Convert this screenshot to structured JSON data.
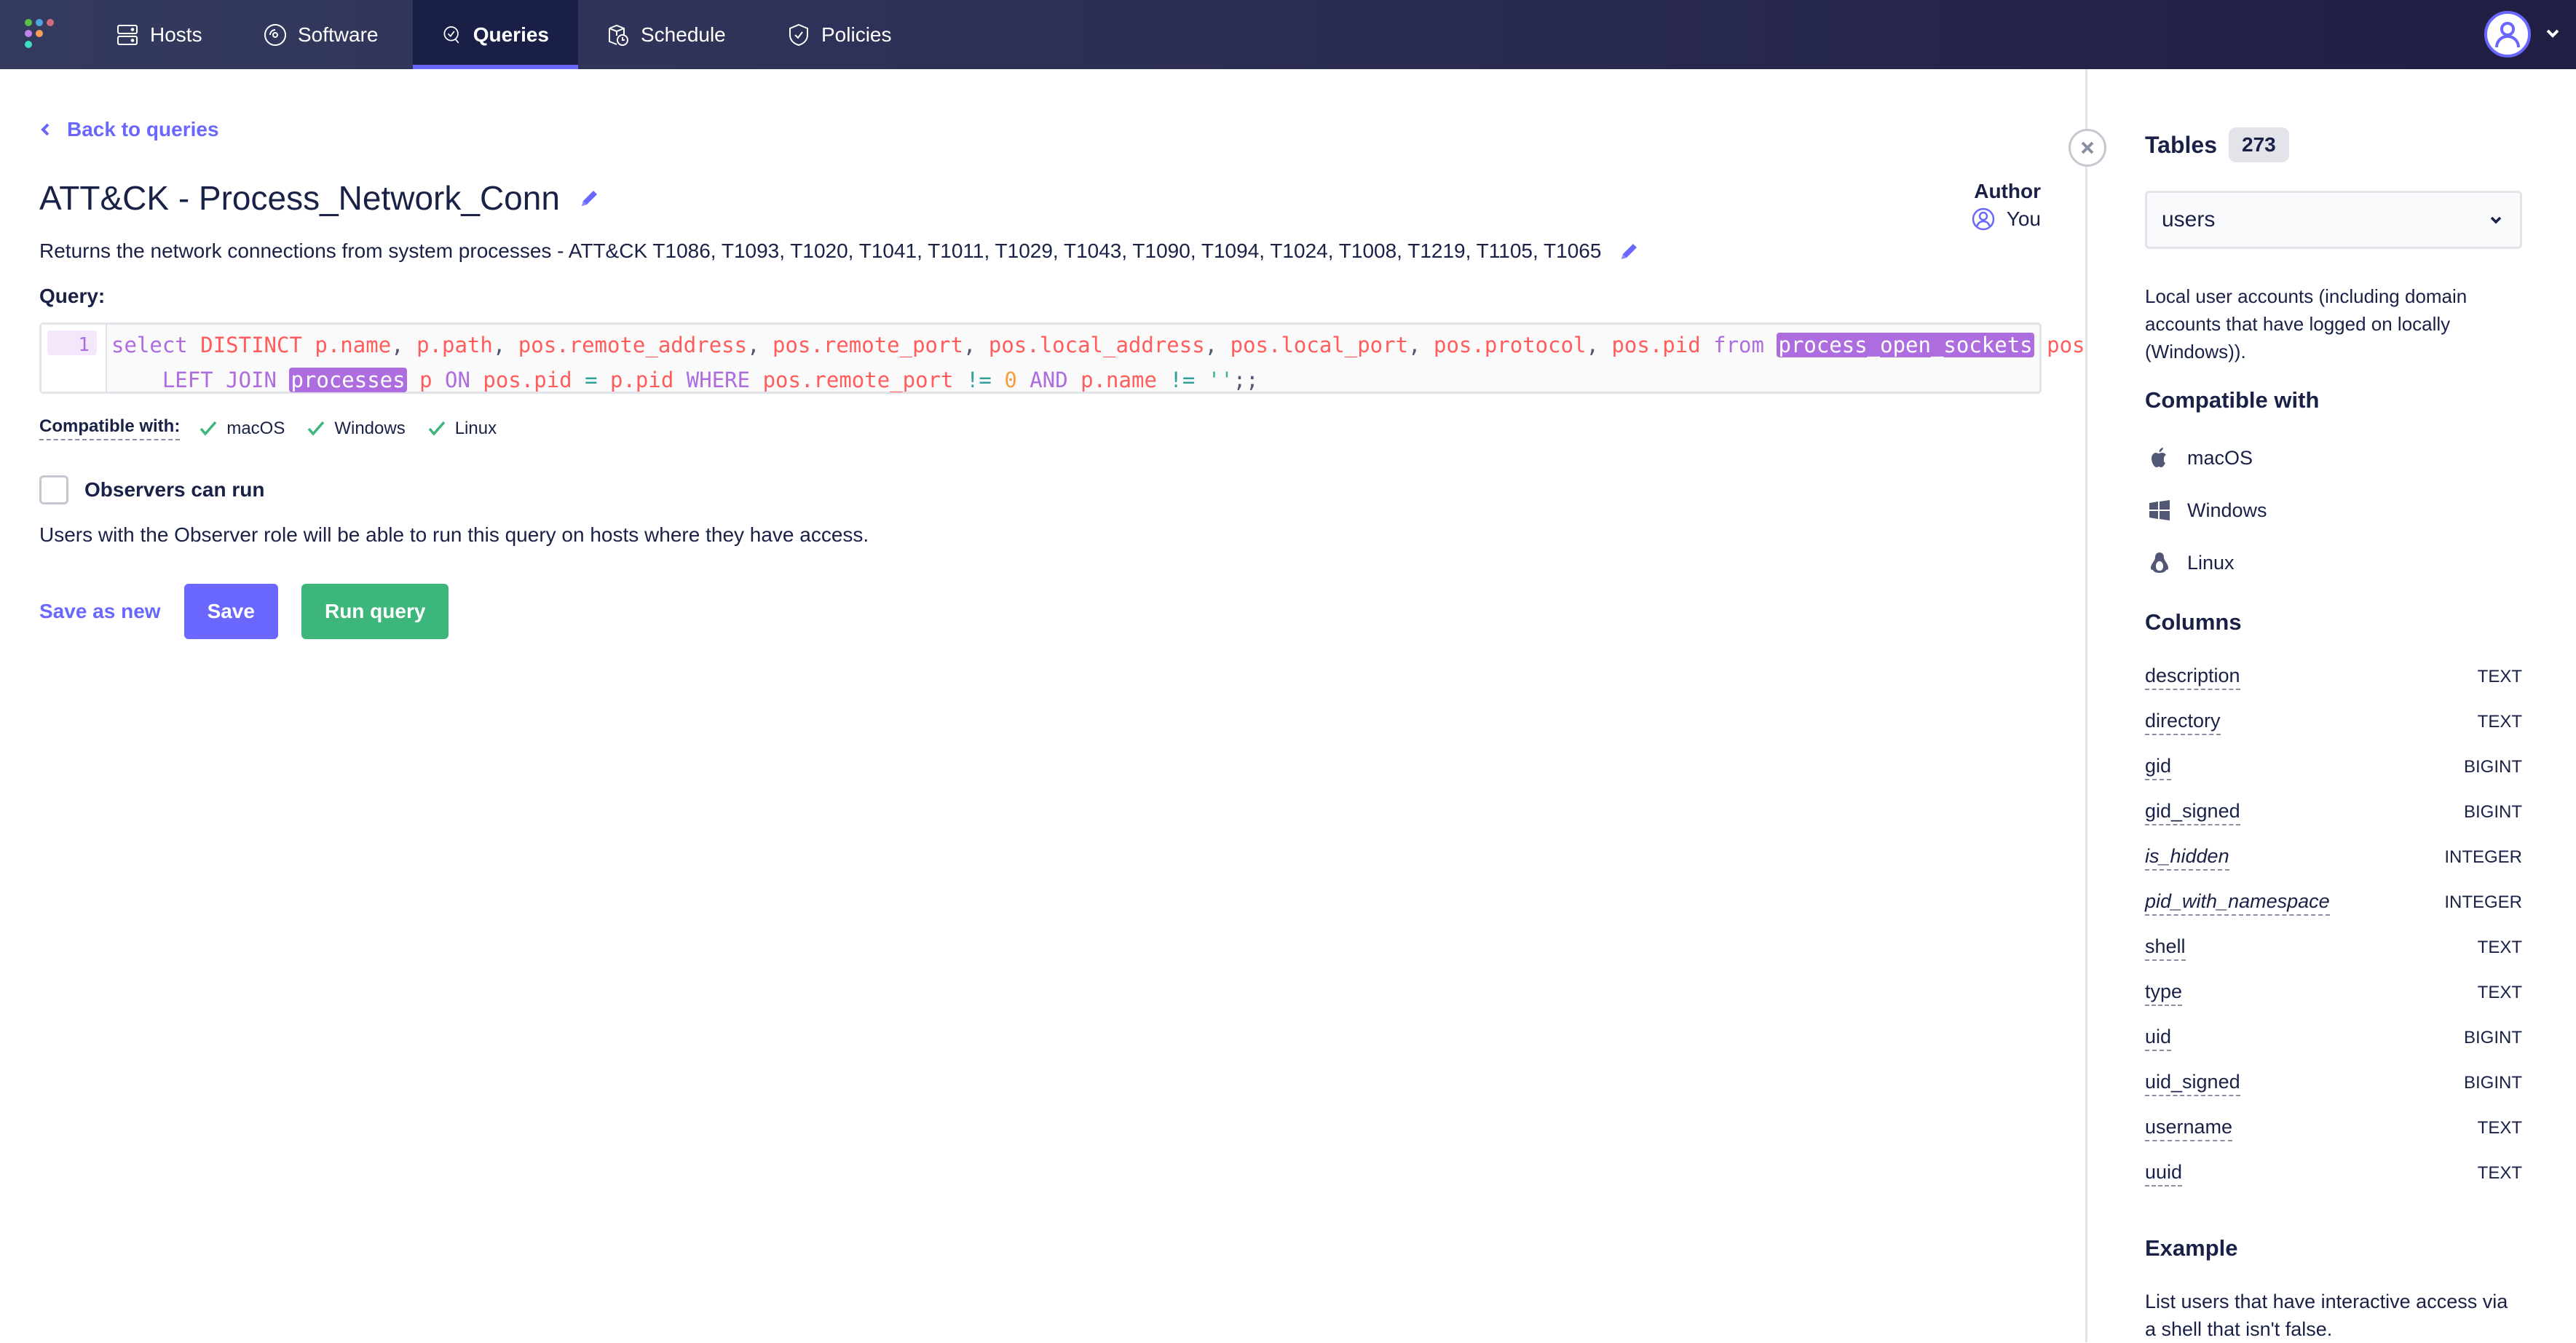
{
  "nav": {
    "logo_colors": [
      "#5bc044",
      "#4fa4e0",
      "#d16b7d",
      "#c382ea",
      "#f79f5b",
      "#3ee0c1"
    ],
    "items": [
      {
        "label": "Hosts",
        "icon": "hosts-icon",
        "active": false
      },
      {
        "label": "Software",
        "icon": "software-icon",
        "active": false
      },
      {
        "label": "Queries",
        "icon": "queries-icon",
        "active": true
      },
      {
        "label": "Schedule",
        "icon": "schedule-icon",
        "active": false
      },
      {
        "label": "Policies",
        "icon": "policies-icon",
        "active": false
      }
    ],
    "avatar_icon": "user-avatar-icon"
  },
  "main": {
    "back_label": "Back to queries",
    "title": "ATT&CK - Process_Network_Conn",
    "description": "Returns the network connections from system processes - ATT&CK T1086, T1093, T1020, T1041, T1011, T1029, T1043, T1090, T1094, T1024, T1008, T1219, T1105, T1065",
    "author": {
      "label": "Author",
      "name": "You"
    },
    "query_label": "Query:",
    "editor": {
      "line_number": "1",
      "query": "select DISTINCT p.name, p.path, pos.remote_address, pos.remote_port, pos.local_address, pos.local_port, pos.protocol, pos.pid from process_open_sockets pos LEFT JOIN processes p ON pos.pid = p.pid WHERE pos.remote_port != 0 AND p.name != '';;",
      "highlighted_tables": [
        "process_open_sockets",
        "processes"
      ]
    },
    "compatible": {
      "label": "Compatible with:",
      "platforms": [
        "macOS",
        "Windows",
        "Linux"
      ]
    },
    "observer": {
      "label": "Observers can run",
      "checked": false,
      "description": "Users with the Observer role will be able to run this query on hosts where they have access."
    },
    "actions": {
      "save_as_new": "Save as new",
      "save": "Save",
      "run": "Run query"
    }
  },
  "sidebar": {
    "tables_label": "Tables",
    "tables_count": "273",
    "selected_table": "users",
    "table_description": "Local user accounts (including domain accounts that have logged on locally (Windows)).",
    "compatible_title": "Compatible with",
    "platforms": [
      {
        "label": "macOS",
        "icon": "apple-icon"
      },
      {
        "label": "Windows",
        "icon": "windows-icon"
      },
      {
        "label": "Linux",
        "icon": "linux-icon"
      }
    ],
    "columns_title": "Columns",
    "columns": [
      {
        "name": "description",
        "type": "TEXT",
        "italic": false
      },
      {
        "name": "directory",
        "type": "TEXT",
        "italic": false
      },
      {
        "name": "gid",
        "type": "BIGINT",
        "italic": false
      },
      {
        "name": "gid_signed",
        "type": "BIGINT",
        "italic": false
      },
      {
        "name": "is_hidden",
        "type": "INTEGER",
        "italic": true
      },
      {
        "name": "pid_with_namespace",
        "type": "INTEGER",
        "italic": true
      },
      {
        "name": "shell",
        "type": "TEXT",
        "italic": false
      },
      {
        "name": "type",
        "type": "TEXT",
        "italic": false
      },
      {
        "name": "uid",
        "type": "BIGINT",
        "italic": false
      },
      {
        "name": "uid_signed",
        "type": "BIGINT",
        "italic": false
      },
      {
        "name": "username",
        "type": "TEXT",
        "italic": false
      },
      {
        "name": "uuid",
        "type": "TEXT",
        "italic": false
      }
    ],
    "example_title": "Example",
    "example_description": "List users that have interactive access via a shell that isn't false."
  },
  "colors": {
    "accent": "#6a67fe",
    "success": "#3db67b",
    "text": "#192147",
    "nav_active_bg": "#1a1f47"
  }
}
